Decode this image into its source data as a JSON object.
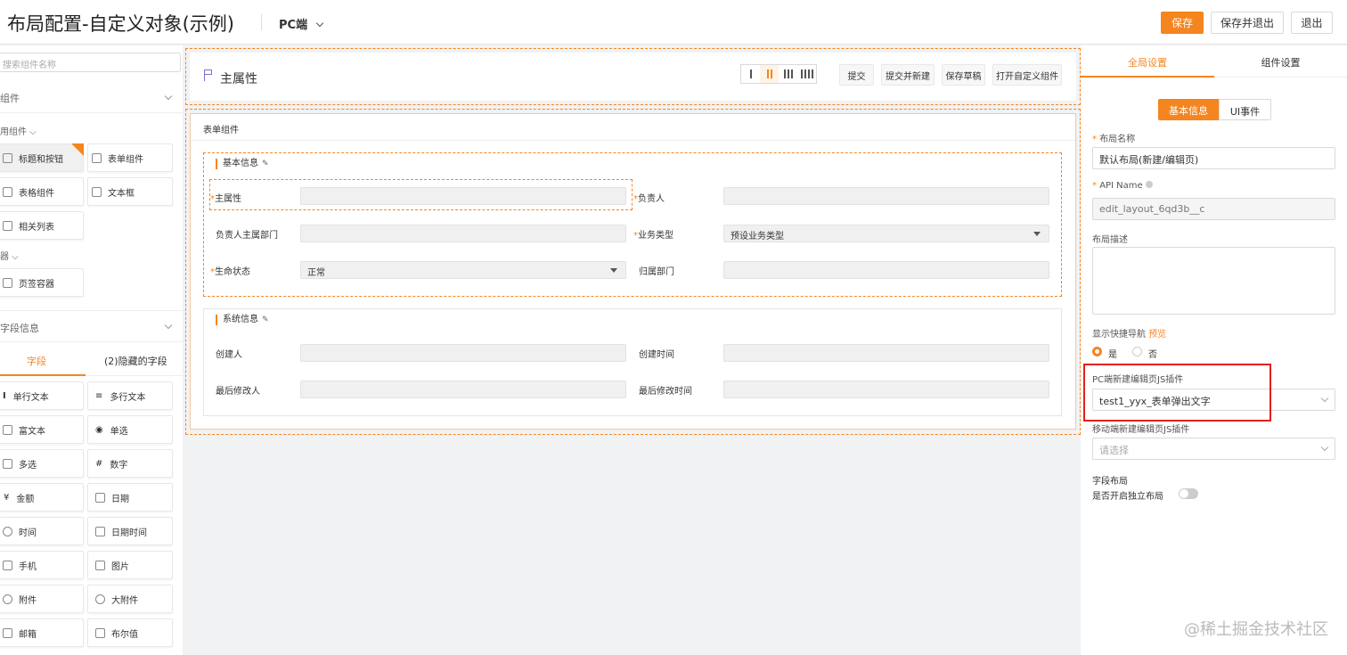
{
  "header": {
    "title": "布局配置-自定义对象(示例)",
    "platform": "PC端",
    "save": "保存",
    "save_exit": "保存并退出",
    "exit": "退出"
  },
  "left": {
    "search_placeholder": "搜索组件名称",
    "components_label": "组件",
    "common_label": "用组件",
    "common_items": [
      "标题和按钮",
      "表单组件",
      "表格组件",
      "文本框",
      "相关列表"
    ],
    "container_label": "器",
    "container_items": [
      "页签容器"
    ],
    "fieldinfo_label": "字段信息",
    "field_tabs": [
      "字段",
      "(2)隐藏的字段"
    ],
    "fields": [
      "单行文本",
      "多行文本",
      "富文本",
      "单选",
      "多选",
      "数字",
      "金额",
      "日期",
      "时间",
      "日期时间",
      "手机",
      "图片",
      "附件",
      "大附件",
      "邮箱",
      "布尔值"
    ]
  },
  "canvas": {
    "header_title": "主属性",
    "actions": [
      "提交",
      "提交并新建",
      "保存草稿",
      "打开自定义组件"
    ],
    "form_title": "表单组件",
    "basic_group": "基本信息",
    "basic_fields": [
      {
        "label": "主属性",
        "required": "*",
        "value": ""
      },
      {
        "label": "负责人",
        "required": "*",
        "value": ""
      },
      {
        "label": "负责人主属部门",
        "required": "",
        "value": ""
      },
      {
        "label": "业务类型",
        "required": "*",
        "value": "预设业务类型"
      },
      {
        "label": "生命状态",
        "required": "*",
        "value": "正常"
      },
      {
        "label": "归属部门",
        "required": "",
        "value": ""
      }
    ],
    "system_group": "系统信息",
    "system_fields": [
      {
        "label": "创建人",
        "value": ""
      },
      {
        "label": "创建时间",
        "value": ""
      },
      {
        "label": "最后修改人",
        "value": ""
      },
      {
        "label": "最后修改时间",
        "value": ""
      }
    ]
  },
  "right": {
    "tabs": [
      "全局设置",
      "组件设置"
    ],
    "subtabs": [
      "基本信息",
      "UI事件"
    ],
    "layout_name_label": "布局名称",
    "layout_name_value": "默认布局(新建/编辑页)",
    "api_label": "API Name",
    "api_value": "edit_layout_6qd3b__c",
    "desc_label": "布局描述",
    "nav_label": "显示快捷导航",
    "nav_preview": "预览",
    "yes": "是",
    "no": "否",
    "pc_plugin_label": "PC端新建编辑页JS插件",
    "pc_plugin_value": "test1_yyx_表单弹出文字",
    "mobile_plugin_label": "移动端新建编辑页JS插件",
    "mobile_plugin_placeholder": "请选择",
    "field_layout_label": "字段布局",
    "independent_label": "是否开启独立布局",
    "accent": "#f5851f",
    "highlight": "#e02020"
  },
  "watermark": "@稀土掘金技术社区"
}
